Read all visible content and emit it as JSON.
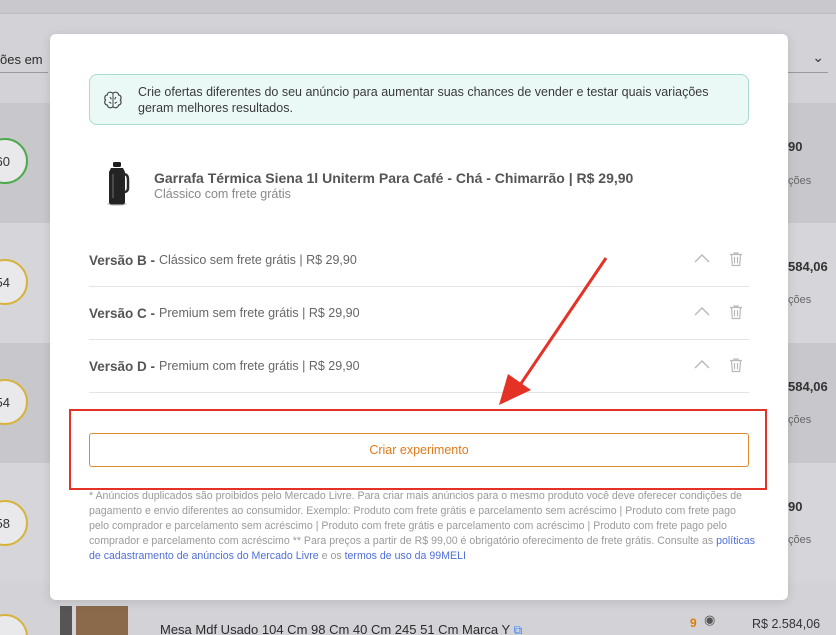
{
  "background": {
    "filter_label": "ões em",
    "rows": [
      {
        "score": "60",
        "price": "90",
        "sub": "ções"
      },
      {
        "score": "54",
        "price": "584,06",
        "sub": "ções"
      },
      {
        "score": "54",
        "price": "584,06",
        "sub": "ções"
      },
      {
        "score": "58",
        "price": "90",
        "sub": "ções"
      }
    ],
    "bottom_row": {
      "title": "Mesa Mdf Usado 104 Cm 98 Cm 40 Cm 245 51 Cm Marca Y",
      "visits": "9",
      "price": "R$ 2.584,06"
    }
  },
  "modal": {
    "info_text": "Crie ofertas diferentes do seu anúncio para aumentar suas chances de vender e testar quais variações geram melhores resultados.",
    "product": {
      "title": "Garrafa Térmica Siena 1l Uniterm Para Café - Chá - Chimarrão | R$ 29,90",
      "subtitle": "Clássico com frete grátis"
    },
    "versions": [
      {
        "name": "Versão B -",
        "desc": "Clássico sem frete grátis | R$ 29,90"
      },
      {
        "name": "Versão C -",
        "desc": "Premium sem frete grátis | R$ 29,90"
      },
      {
        "name": "Versão D -",
        "desc": "Premium com frete grátis | R$ 29,90"
      }
    ],
    "create_button": "Criar experimento",
    "disclaimer": {
      "text": "* Anúncios duplicados são proibidos pelo Mercado Livre. Para criar mais anúncios para o mesmo produto você deve oferecer condições de pagamento e envio diferentes ao consumidor. Exemplo: Produto com frete grátis e parcelamento sem acréscimo | Produto com frete pago pelo comprador e parcelamento sem acréscimo | Produto com frete grátis e parcelamento com acréscimo | Produto com frete pago pelo comprador e parcelamento com acréscimo ** Para preços a partir de R$ 99,00 é obrigatório oferecimento de frete grátis. Consulte as ",
      "link1": "políticas de cadastramento de anúncios do Mercado Livre",
      "mid": " e os ",
      "link2": "termos de uso da 99MELI"
    }
  },
  "colors": {
    "accent_orange": "#e07a1a",
    "annotation_red": "#e53227",
    "info_bg": "#eaf9f6",
    "link_blue": "#4f6fd8"
  }
}
